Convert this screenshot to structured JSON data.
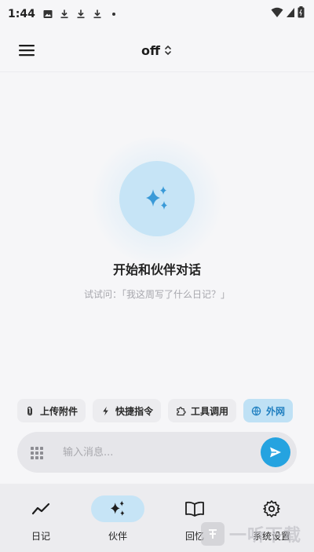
{
  "status_bar": {
    "time": "1:44",
    "left_icons": [
      "image-icon",
      "download-icon",
      "download-icon",
      "download-icon",
      "dot-icon"
    ],
    "right_icons": [
      "wifi-icon",
      "signal-icon",
      "battery-icon"
    ]
  },
  "top_bar": {
    "title": "off",
    "menu_icon": "hamburger-menu-icon",
    "title_icon": "unfold-icon"
  },
  "empty_state": {
    "icon": "sparkles-icon",
    "title": "开始和伙伴对话",
    "hint": "试试问：「我这周写了什么日记？」"
  },
  "quick_actions": [
    {
      "icon": "paperclip-icon",
      "label": "上传附件",
      "active": false
    },
    {
      "icon": "bolt-icon",
      "label": "快捷指令",
      "active": false
    },
    {
      "icon": "puzzle-icon",
      "label": "工具调用",
      "active": false
    },
    {
      "icon": "globe-icon",
      "label": "外网",
      "active": true
    }
  ],
  "input": {
    "placeholder": "输入消息...",
    "value": "",
    "left_icon": "keypad-grid-icon",
    "send_icon": "send-icon"
  },
  "bottom_nav": [
    {
      "icon": "trend-line-icon",
      "label": "日记",
      "active": false
    },
    {
      "icon": "sparkles-icon",
      "label": "伙伴",
      "active": true
    },
    {
      "icon": "book-icon",
      "label": "回忆",
      "active": false
    },
    {
      "icon": "gear-icon",
      "label": "系统设置",
      "active": false
    }
  ],
  "watermark": {
    "text": "一听下载"
  },
  "colors": {
    "accent": "#25a3e0",
    "accent_light": "#c6e4f6",
    "background": "#f6f6f8",
    "chip_bg": "#ececef"
  }
}
